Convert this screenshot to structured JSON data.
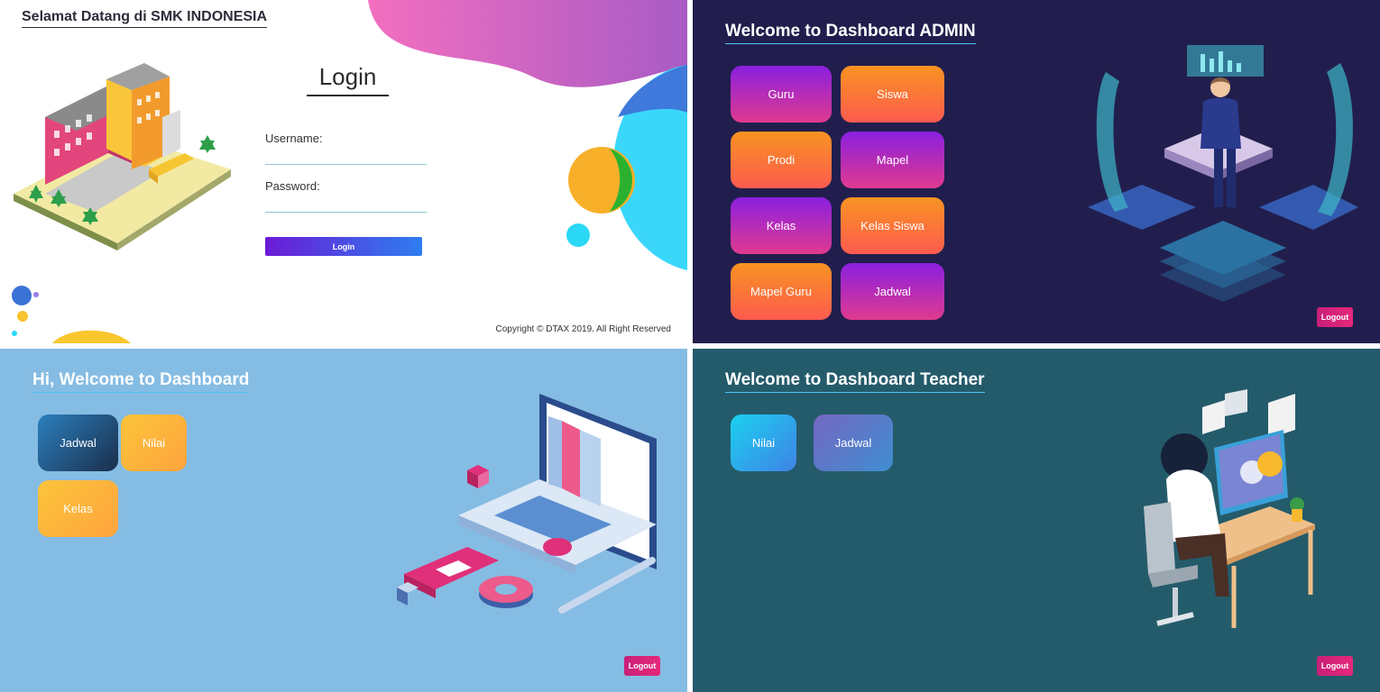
{
  "login": {
    "header_title": "Selamat Datang di SMK INDONESIA",
    "heading": "Login",
    "username_label": "Username:",
    "password_label": "Password:",
    "username_value": "",
    "password_value": "",
    "button_label": "Login",
    "copyright": "Copyright © DTAX 2019. All Right Reserved"
  },
  "admin": {
    "title": "Welcome to Dashboard ADMIN",
    "tiles": [
      "Guru",
      "Siswa",
      "Prodi",
      "Mapel",
      "Kelas",
      "Kelas Siswa",
      "Mapel Guru",
      "Jadwal"
    ],
    "logout_label": "Logout"
  },
  "student": {
    "title": "Hi, Welcome to Dashboard",
    "tiles": [
      "Jadwal",
      "Nilai",
      "Kelas"
    ],
    "logout_label": "Logout"
  },
  "teacher": {
    "title": "Welcome to Dashboard Teacher",
    "tiles": [
      "Nilai",
      "Jadwal"
    ],
    "logout_label": "Logout"
  },
  "colors": {
    "admin_bg": "#211e4d",
    "student_bg": "#85bce3",
    "teacher_bg": "#245b6b",
    "logout": "#e0287a",
    "login_button": "#6a1bd6"
  },
  "icons": [
    "school-building-illustration",
    "businessman-hologram-illustration",
    "laptop-books-illustration",
    "teacher-computer-illustration"
  ]
}
